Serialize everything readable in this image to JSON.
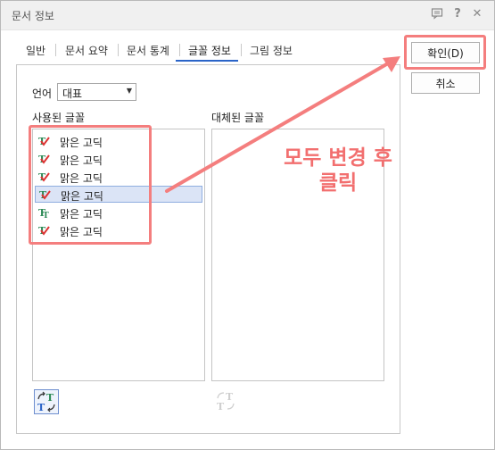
{
  "window": {
    "title": "문서 정보",
    "title_icons": [
      "message-icon",
      "help-icon",
      "close-icon"
    ],
    "title_glyphs": {
      "help": "?",
      "close": "✕"
    }
  },
  "tabs": [
    {
      "label": "일반",
      "active": false
    },
    {
      "label": "문서 요약",
      "active": false
    },
    {
      "label": "문서 통계",
      "active": false
    },
    {
      "label": "글꼴 정보",
      "active": true
    },
    {
      "label": "그림 정보",
      "active": false
    }
  ],
  "buttons": {
    "ok": "확인(D)",
    "cancel": "취소"
  },
  "language": {
    "label": "언어",
    "value": "대표"
  },
  "used_fonts": {
    "label": "사용된 글꼴",
    "items": [
      {
        "label": "맑은 고딕",
        "icon": "truetype-check-icon"
      },
      {
        "label": "맑은 고딕",
        "icon": "truetype-check-icon"
      },
      {
        "label": "맑은 고딕",
        "icon": "truetype-check-icon"
      },
      {
        "label": "맑은 고딕",
        "icon": "truetype-check-icon",
        "selected": true
      },
      {
        "label": "맑은 고딕",
        "icon": "truetype-icon"
      },
      {
        "label": "맑은 고딕",
        "icon": "truetype-check-icon"
      }
    ]
  },
  "replaced_fonts": {
    "label": "대체된 글꼴",
    "items": []
  },
  "annotation": {
    "line1": "모두 변경 후",
    "line2": "클릭",
    "color": "#f47e7e"
  },
  "colors": {
    "accent": "#2a64c8",
    "highlight": "#f47e7e",
    "selection": "#dbe4f6"
  }
}
